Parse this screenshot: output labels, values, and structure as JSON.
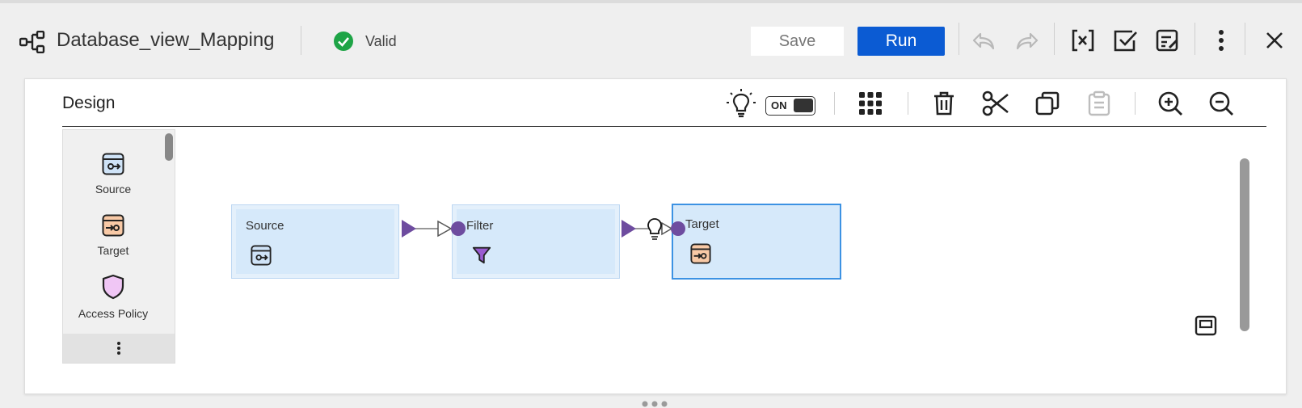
{
  "header": {
    "title": "Database_view_Mapping",
    "status": "Valid",
    "save_label": "Save",
    "run_label": "Run"
  },
  "design": {
    "label": "Design",
    "toggle_label": "ON"
  },
  "palette": {
    "items": [
      {
        "label": "Source",
        "icon": "source-icon"
      },
      {
        "label": "Target",
        "icon": "target-icon"
      },
      {
        "label": "Access Policy",
        "icon": "access-policy-icon"
      }
    ]
  },
  "nodes": [
    {
      "title": "Source",
      "icon": "source-icon"
    },
    {
      "title": "Filter",
      "icon": "filter-icon"
    },
    {
      "title": "Target",
      "icon": "target-icon"
    }
  ],
  "colors": {
    "run_button": "#0b5bd3",
    "valid_green": "#1ea446",
    "node_fill": "#d6e9fa",
    "selected_border": "#3c92e3",
    "port_purple": "#6e4c9f",
    "filter_purple": "#9a5bd1",
    "source_icon_fill": "#cfe3f7",
    "target_icon_fill": "#f8c9a6",
    "access_policy_fill": "#f0c6f5"
  }
}
